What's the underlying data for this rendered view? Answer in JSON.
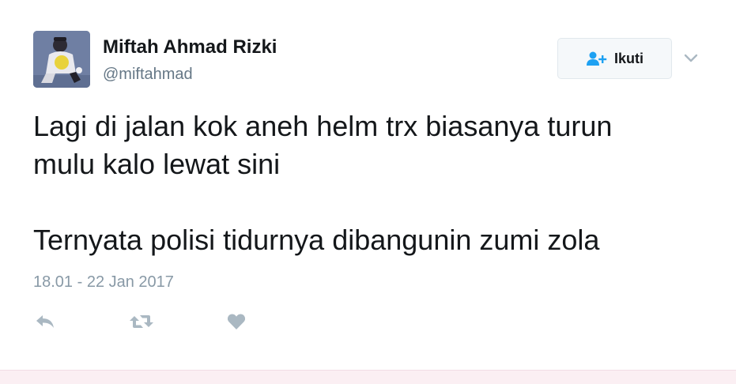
{
  "user": {
    "name": "Miftah Ahmad Rizki",
    "handle": "@miftahmad"
  },
  "follow_button": {
    "label": "Ikuti",
    "icon": "add-user-icon"
  },
  "menu": {
    "icon": "chevron-down-icon"
  },
  "tweet": {
    "line1": "Lagi di jalan kok aneh helm trx biasanya turun",
    "line2": "mulu kalo lewat sini",
    "line3": "Ternyata polisi tidurnya dibangunin zumi zola",
    "timestamp": "18.01 - 22 Jan 2017"
  },
  "actions": [
    {
      "name": "reply",
      "icon": "reply-icon"
    },
    {
      "name": "retweet",
      "icon": "retweet-icon"
    },
    {
      "name": "like",
      "icon": "heart-icon"
    }
  ],
  "colors": {
    "accent": "#1da1f2",
    "icon_gray": "#aab8c2",
    "text_primary": "#14171a",
    "text_secondary": "#657786"
  }
}
